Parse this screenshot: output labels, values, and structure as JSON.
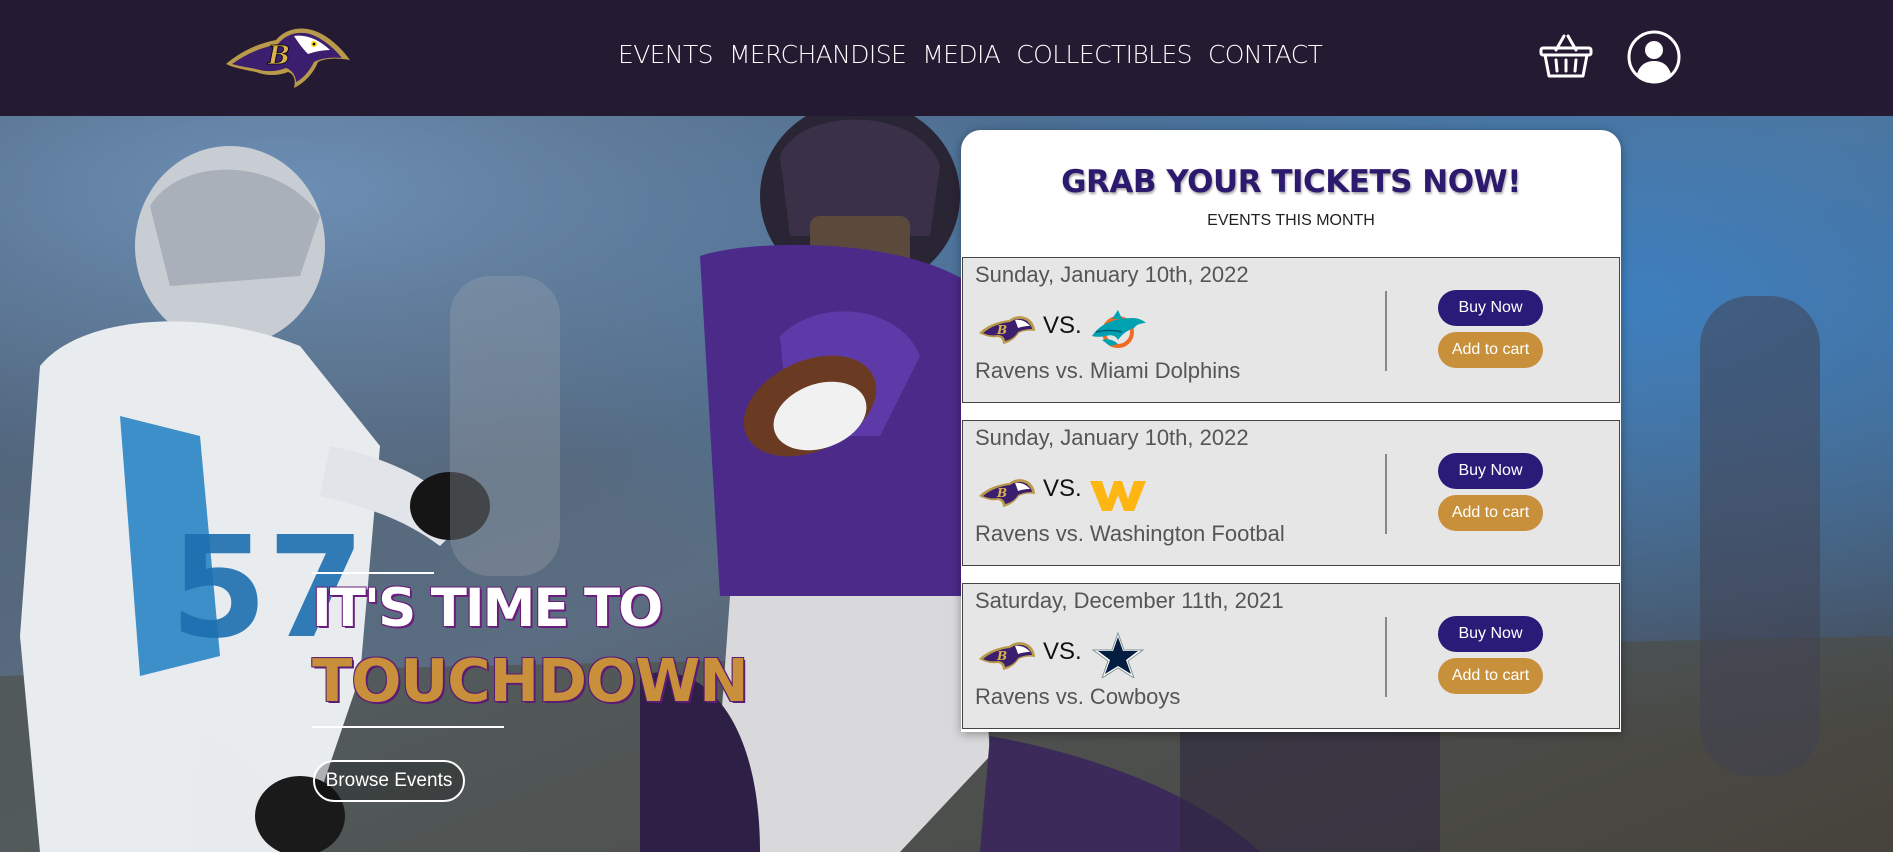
{
  "nav": {
    "items": [
      "EVENTS",
      "MERCHANDISE",
      "MEDIA",
      "COLLECTIBLES",
      "CONTACT"
    ]
  },
  "hero": {
    "line1": "IT'S TIME TO",
    "line2": "TOUCHDOWN",
    "browse_label": "Browse Events"
  },
  "tickets": {
    "title": "GRAB YOUR TICKETS NOW!",
    "subtitle": "EVENTS THIS MONTH",
    "events": [
      {
        "date": "Sunday, January 10th, 2022",
        "vs": "VS.",
        "name": "Ravens vs. Miami Dolphins",
        "opponent_icon": "dolphins-logo-icon",
        "buy_label": "Buy Now",
        "cart_label": "Add to cart"
      },
      {
        "date": "Sunday, January 10th, 2022",
        "vs": "VS.",
        "name": "Ravens vs. Washington Footbal",
        "opponent_icon": "washington-logo-icon",
        "buy_label": "Buy Now",
        "cart_label": "Add to cart"
      },
      {
        "date": "Saturday, December 11th, 2021",
        "vs": "VS.",
        "name": "Ravens vs. Cowboys",
        "opponent_icon": "cowboys-star-icon",
        "buy_label": "Buy Now",
        "cart_label": "Add to cart"
      }
    ]
  },
  "colors": {
    "header_bg": "#241a31",
    "brand_purple": "#2a1b78",
    "brand_gold": "#c8903a",
    "card_bg": "#e6e6e6"
  },
  "icons": {
    "logo": "ravens-logo-icon",
    "cart": "shopping-basket-icon",
    "user": "user-account-icon"
  }
}
